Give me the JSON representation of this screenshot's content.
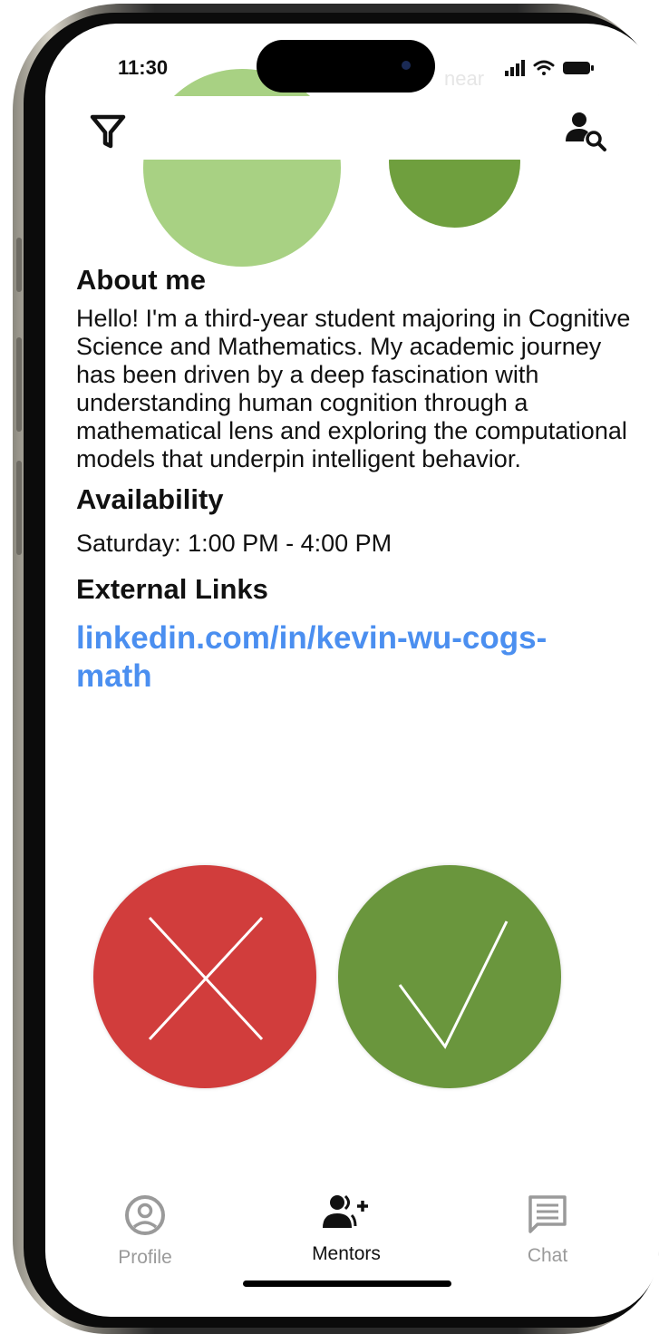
{
  "status_bar": {
    "time": "11:30",
    "ghost_label": "near"
  },
  "header": {
    "filter_icon": "filter-icon",
    "mentor_search_icon": "person-search-icon"
  },
  "profile": {
    "about_title": "About me",
    "about_text": "Hello! I'm a third-year student majoring in Cognitive Science and Mathematics. My academic journey has been driven by a deep fascination with understanding human cognition through a mathematical lens and exploring the computational models that underpin intelligent behavior.",
    "availability_title": "Availability",
    "availability_text": "Saturday: 1:00 PM - 4:00 PM",
    "links_title": "External Links",
    "link": "linkedin.com/in/kevin-wu-cogs-math"
  },
  "actions": {
    "reject_icon": "x-icon",
    "accept_icon": "checkmark-icon",
    "reject_color": "#d13d3c",
    "accept_color": "#6a963d"
  },
  "tabbar": {
    "tabs": [
      {
        "label": "Profile",
        "icon": "profile-circle-icon",
        "active": false
      },
      {
        "label": "Mentors",
        "icon": "add-people-icon",
        "active": true
      },
      {
        "label": "Chat",
        "icon": "chat-icon",
        "active": false
      }
    ]
  },
  "colors": {
    "link": "#4b8ff0",
    "avatar_light_green": "#a8d183",
    "avatar_dark_green": "#6f9f3e"
  }
}
